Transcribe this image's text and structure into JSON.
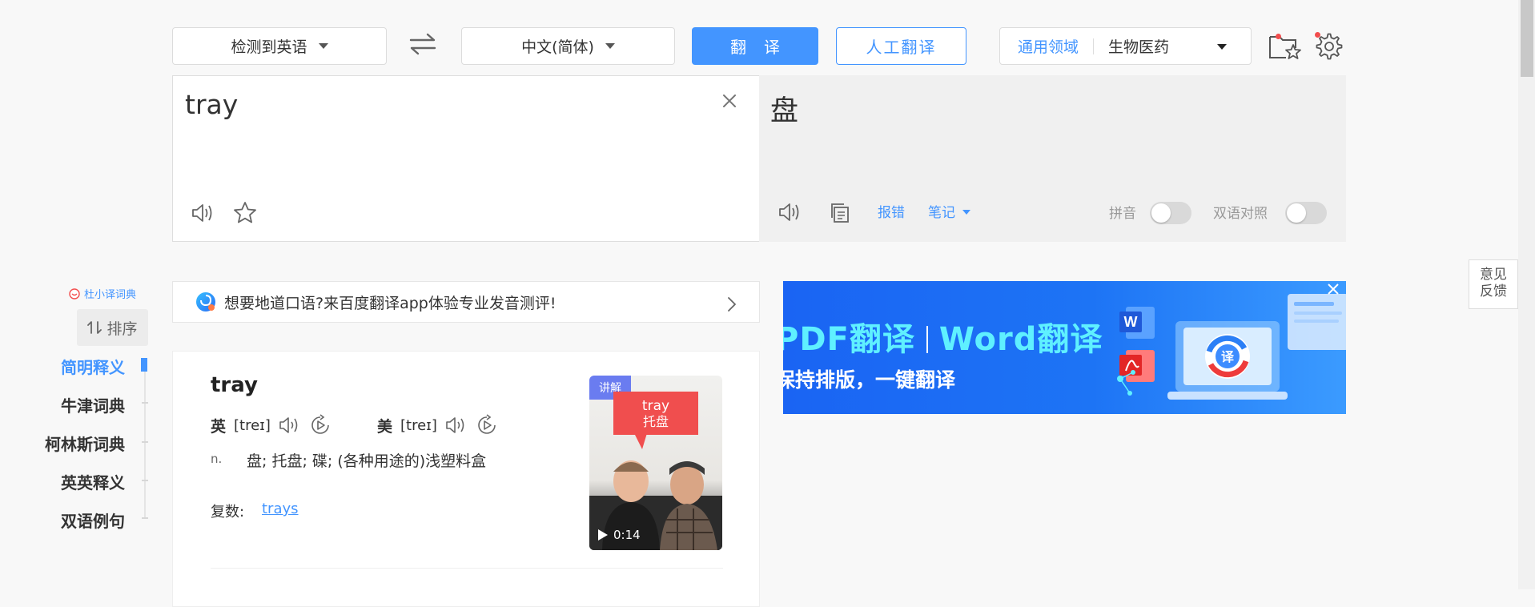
{
  "topbar": {
    "source_lang": "检测到英语",
    "target_lang": "中文(简体)",
    "translate_button": "翻译",
    "human_translate_button": "人工翻译",
    "domain_label": "通用领域",
    "domain_value": "生物医药"
  },
  "source": {
    "text": "tray"
  },
  "target": {
    "text": "盘",
    "report_error": "报错",
    "notes": "笔记",
    "pinyin_label": "拼音",
    "bilingual_label": "双语对照",
    "pinyin_on": false,
    "bilingual_on": false
  },
  "sidebar": {
    "brand": "杜小译词典",
    "sort_label": "排序",
    "items": [
      {
        "label": "简明释义",
        "active": true
      },
      {
        "label": "牛津词典",
        "active": false
      },
      {
        "label": "柯林斯词典",
        "active": false
      },
      {
        "label": "英英释义",
        "active": false
      },
      {
        "label": "双语例句",
        "active": false
      }
    ]
  },
  "promo": {
    "text": "想要地道口语?来百度翻译app体验专业发音测评!"
  },
  "ad": {
    "line1_a": "PDF翻译",
    "line1_b": "Word翻译",
    "line2": "保持排版，一键翻译",
    "badge": "译"
  },
  "feedback": {
    "line1": "意见",
    "line2": "反馈"
  },
  "dictionary": {
    "word": "tray",
    "uk_label": "英",
    "uk_phonetic": "[treɪ]",
    "us_label": "美",
    "us_phonetic": "[treɪ]",
    "pos": "n.",
    "meaning": "盘;  托盘;  碟;  (各种用途的)浅塑料盒",
    "plural_label": "复数:",
    "plural_value": "trays",
    "video": {
      "tag": "讲解",
      "bubble_en": "tray",
      "bubble_zh": "托盘",
      "duration": "0:14"
    }
  },
  "colors": {
    "accent": "#4395ff",
    "alert": "#f24d4d"
  }
}
